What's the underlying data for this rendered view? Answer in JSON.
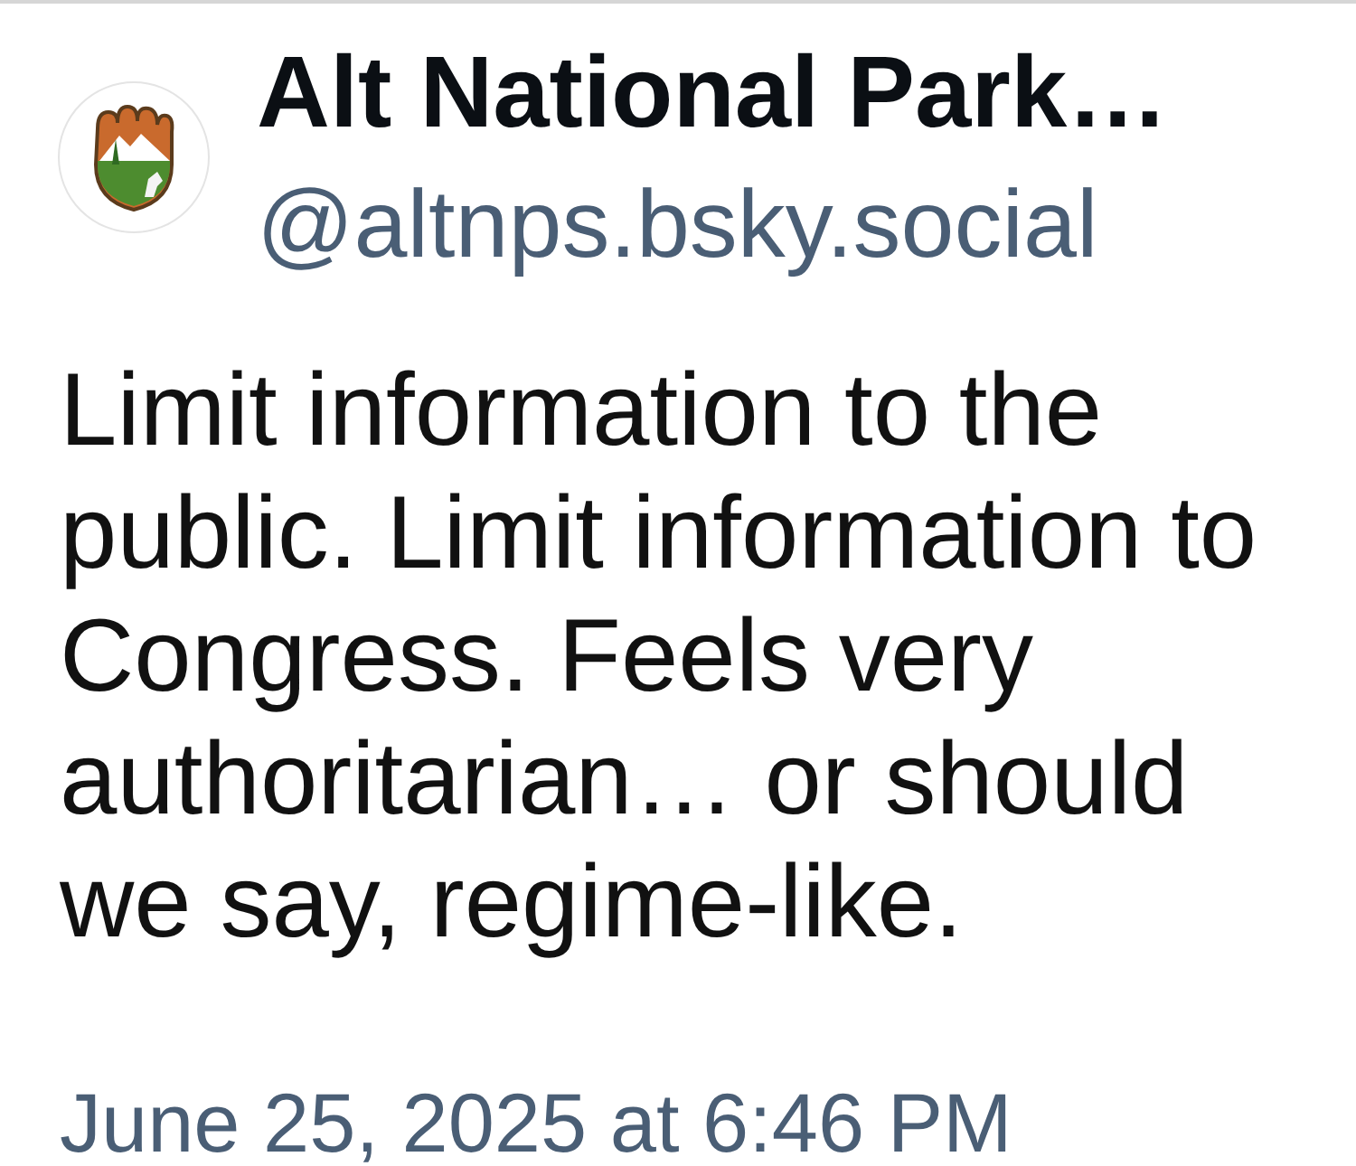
{
  "post": {
    "author": {
      "display_name": "Alt National Park…",
      "handle": "@altnps.bsky.social"
    },
    "text": "Limit information to the public. Limit information to Congress. Feels very authoritarian… or should we say, regime-like.",
    "timestamp": "June 25, 2025 at 6:46 PM"
  }
}
